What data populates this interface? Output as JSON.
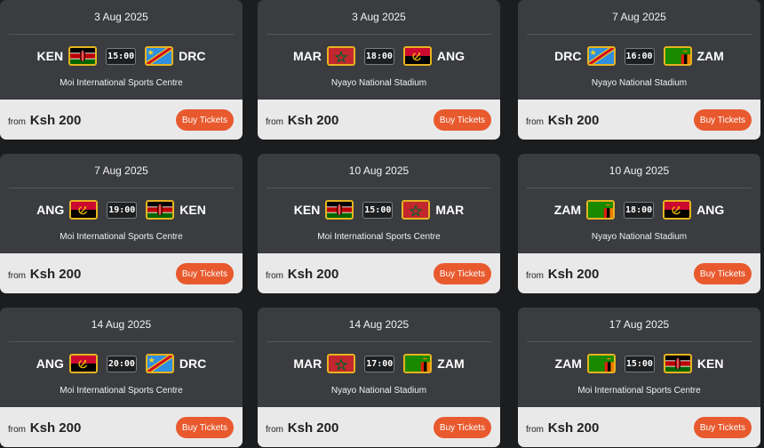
{
  "colors": {
    "accent": "#e8592d",
    "card_bg": "#3a3c3f",
    "footer_bg": "#e9e9ea",
    "flag_border": "#e7b41f"
  },
  "matches": [
    {
      "date": "3 Aug 2025",
      "home": "KEN",
      "away": "DRC",
      "time": "15:00",
      "venue": "Moi International Sports Centre",
      "from_label": "from",
      "price": "Ksh 200",
      "button": "Buy Tickets"
    },
    {
      "date": "3 Aug 2025",
      "home": "MAR",
      "away": "ANG",
      "time": "18:00",
      "venue": "Nyayo National Stadium",
      "from_label": "from",
      "price": "Ksh 200",
      "button": "Buy Tickets"
    },
    {
      "date": "7 Aug 2025",
      "home": "DRC",
      "away": "ZAM",
      "time": "16:00",
      "venue": "Nyayo National Stadium",
      "from_label": "from",
      "price": "Ksh 200",
      "button": "Buy Tickets"
    },
    {
      "date": "7 Aug 2025",
      "home": "ANG",
      "away": "KEN",
      "time": "19:00",
      "venue": "Moi International Sports Centre",
      "from_label": "from",
      "price": "Ksh 200",
      "button": "Buy Tickets"
    },
    {
      "date": "10 Aug 2025",
      "home": "KEN",
      "away": "MAR",
      "time": "15:00",
      "venue": "Moi International Sports Centre",
      "from_label": "from",
      "price": "Ksh 200",
      "button": "Buy Tickets"
    },
    {
      "date": "10 Aug 2025",
      "home": "ZAM",
      "away": "ANG",
      "time": "18:00",
      "venue": "Nyayo National Stadium",
      "from_label": "from",
      "price": "Ksh 200",
      "button": "Buy Tickets"
    },
    {
      "date": "14 Aug 2025",
      "home": "ANG",
      "away": "DRC",
      "time": "20:00",
      "venue": "Moi International Sports Centre",
      "from_label": "from",
      "price": "Ksh 200",
      "button": "Buy Tickets"
    },
    {
      "date": "14 Aug 2025",
      "home": "MAR",
      "away": "ZAM",
      "time": "17:00",
      "venue": "Nyayo National Stadium",
      "from_label": "from",
      "price": "Ksh 200",
      "button": "Buy Tickets"
    },
    {
      "date": "17 Aug 2025",
      "home": "ZAM",
      "away": "KEN",
      "time": "15:00",
      "venue": "Moi International Sports Centre",
      "from_label": "from",
      "price": "Ksh 200",
      "button": "Buy Tickets"
    }
  ]
}
